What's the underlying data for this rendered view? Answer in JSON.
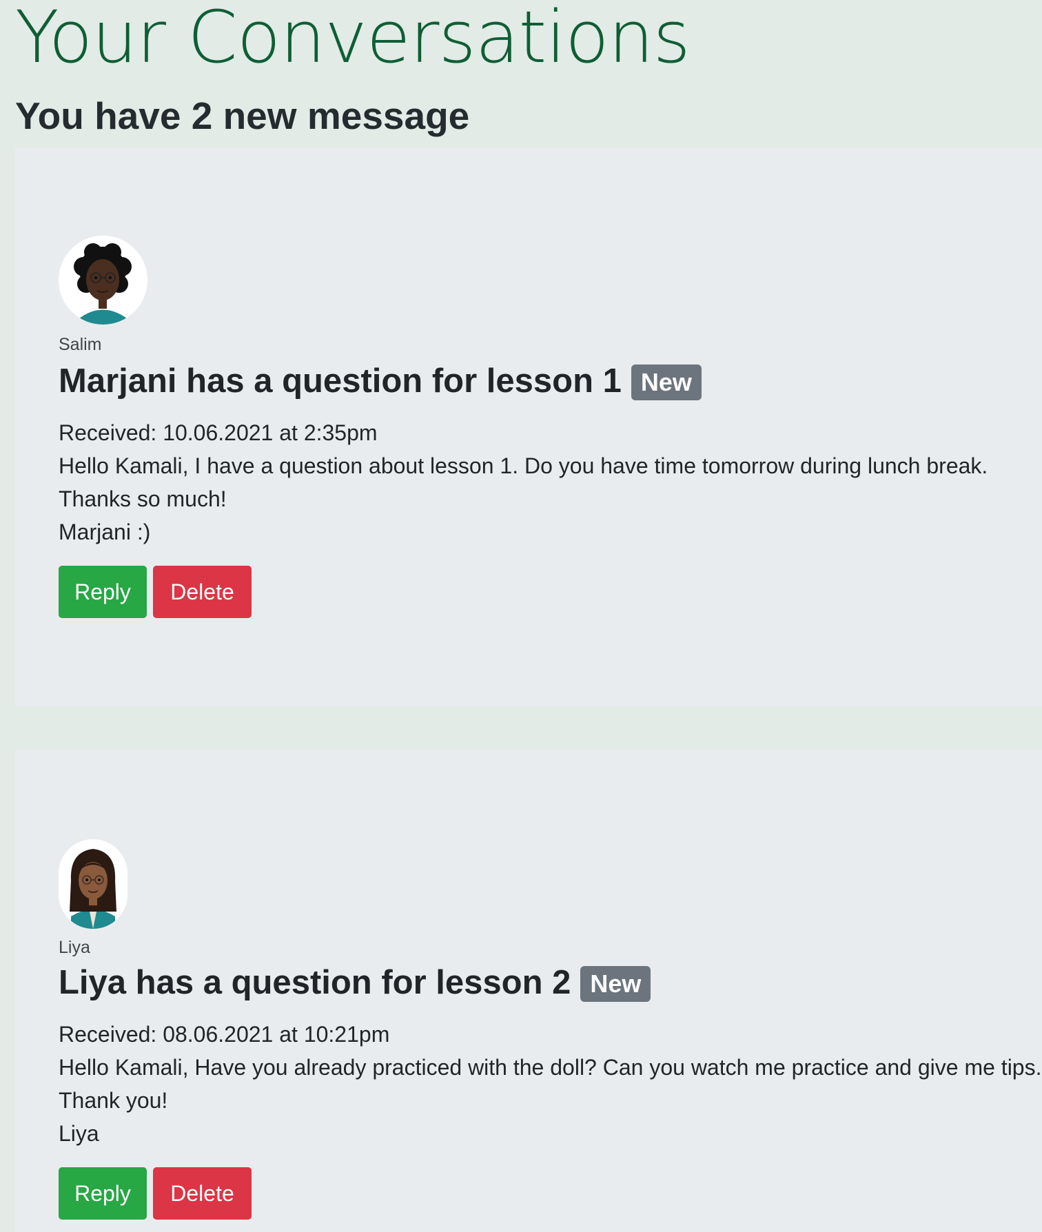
{
  "header": {
    "title": "Your Conversations",
    "subtitle": "You have 2 new message"
  },
  "colors": {
    "page_background": "#e2ebe6",
    "card_background": "#e9ecef",
    "title": "#0f5e35",
    "badge": "#6c757d",
    "reply": "#28a745",
    "delete": "#dc3545"
  },
  "messages": [
    {
      "sender": "Salim",
      "subject": "Marjani has a question for lesson 1",
      "badge": "New",
      "received": "Received: 10.06.2021 at 2:35pm",
      "body": [
        "Hello Kamali, I have a question about lesson 1. Do you have time tomorrow during lunch break.",
        "Thanks so much!",
        "Marjani :)"
      ],
      "reply_label": "Reply",
      "delete_label": "Delete",
      "avatar_icon": "avatar-curly-hair-icon"
    },
    {
      "sender": "Liya",
      "subject": "Liya has a question for lesson 2",
      "badge": "New",
      "received": "Received: 08.06.2021 at 10:21pm",
      "body": [
        "Hello Kamali, Have you already practiced with the doll? Can you watch me practice and give me tips.",
        "Thank you!",
        "Liya"
      ],
      "reply_label": "Reply",
      "delete_label": "Delete",
      "avatar_icon": "avatar-long-hair-icon"
    }
  ]
}
